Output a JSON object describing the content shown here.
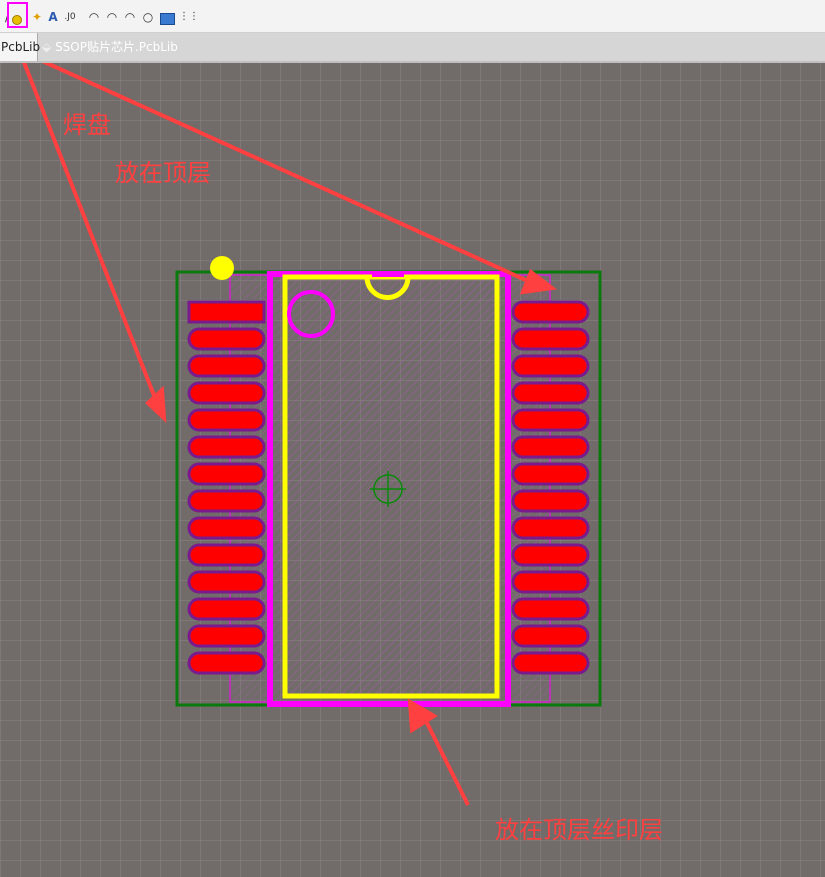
{
  "toolbar": {
    "icons": [
      "line-icon",
      "pad-icon",
      "via-icon",
      "text-icon",
      "string-icon",
      "arc-center-icon",
      "arc-edge-icon",
      "arc-any-icon",
      "circle-icon",
      "rectangle-icon",
      "array-icon"
    ],
    "text_glyph": "A"
  },
  "tabs": {
    "active_label": "PcbLib",
    "file_label": "SSOP贴片芯片.PcbLib"
  },
  "annotations": {
    "pad_label": "焊盘",
    "top_layer_label": "放在顶层",
    "silkscreen_label": "放在顶层丝印层"
  },
  "colors": {
    "canvas": "#716b69",
    "grid": "#8a8583",
    "pad_fill": "#ff0000",
    "pad_border": "#7a1a8c",
    "silkscreen": "#ffff00",
    "courtyard": "#ff00ff",
    "outline": "#0a7a0a",
    "annotation": "#ff4040",
    "toolbar_highlight": "#ff00ff"
  },
  "pads": {
    "left_count": 14,
    "right_count": 14
  }
}
